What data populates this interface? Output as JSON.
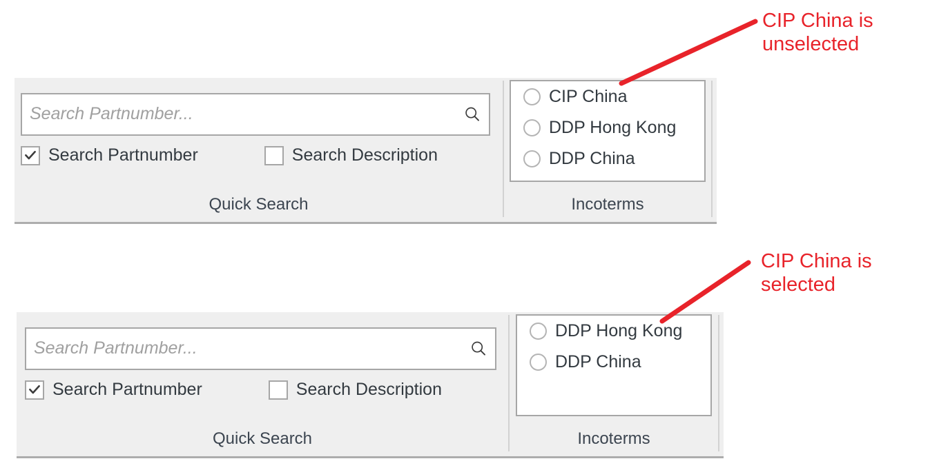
{
  "panels": [
    {
      "id": "panel-top",
      "quick_search": {
        "caption": "Quick Search",
        "input_placeholder": "Search Partnumber...",
        "input_value": "",
        "search_icon": "magnifier-icon",
        "checkboxes": [
          {
            "label": "Search Partnumber",
            "checked": true
          },
          {
            "label": "Search Description",
            "checked": false
          }
        ]
      },
      "incoterms": {
        "caption": "Incoterms",
        "options": [
          {
            "label": "CIP China",
            "selected": false
          },
          {
            "label": "DDP Hong Kong",
            "selected": false
          },
          {
            "label": "DDP China",
            "selected": false
          }
        ]
      }
    },
    {
      "id": "panel-bottom",
      "quick_search": {
        "caption": "Quick Search",
        "input_placeholder": "Search Partnumber...",
        "input_value": "",
        "search_icon": "magnifier-icon",
        "checkboxes": [
          {
            "label": "Search Partnumber",
            "checked": true
          },
          {
            "label": "Search Description",
            "checked": false
          }
        ]
      },
      "incoterms": {
        "caption": "Incoterms",
        "options": [
          {
            "label": "DDP Hong Kong",
            "selected": false
          },
          {
            "label": "DDP China",
            "selected": false
          }
        ]
      }
    }
  ],
  "annotations": [
    {
      "id": "annotation-top",
      "text": "CIP China is\nunselected",
      "color": "#e8232a"
    },
    {
      "id": "annotation-bottom",
      "text": "CIP China is\nselected",
      "color": "#e8232a"
    }
  ]
}
